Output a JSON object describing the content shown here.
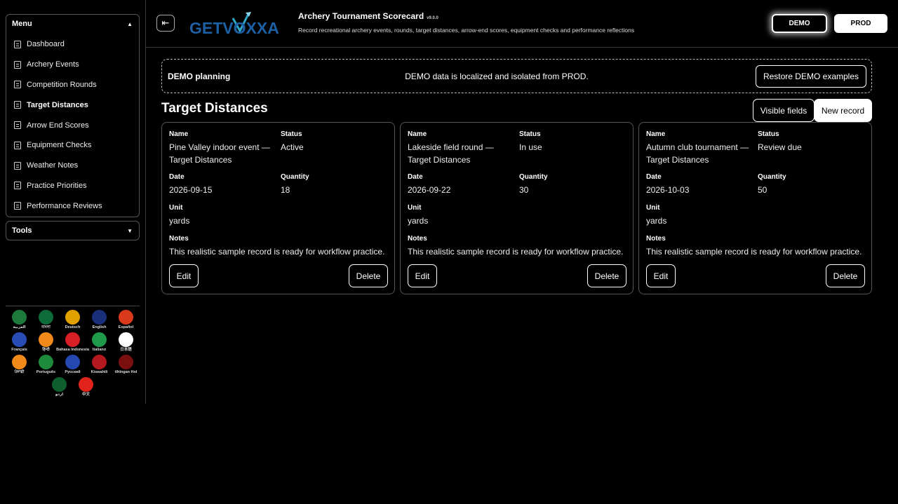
{
  "sidebar": {
    "menu_title": "Menu",
    "tools_title": "Tools",
    "items": [
      {
        "label": "Dashboard"
      },
      {
        "label": "Archery Events"
      },
      {
        "label": "Competition Rounds"
      },
      {
        "label": "Target Distances",
        "active": true
      },
      {
        "label": "Arrow End Scores"
      },
      {
        "label": "Equipment Checks"
      },
      {
        "label": "Weather Notes"
      },
      {
        "label": "Practice Priorities"
      },
      {
        "label": "Performance Reviews"
      }
    ],
    "languages": [
      {
        "label": "العربية",
        "color": "#1e7a3c"
      },
      {
        "label": "বাংলা",
        "color": "#0d6b3a"
      },
      {
        "label": "Deutsch",
        "color": "#e0a000"
      },
      {
        "label": "English",
        "color": "#1a2f7a"
      },
      {
        "label": "Español",
        "color": "#d93a1c"
      },
      {
        "label": "Français",
        "color": "#2a4db5"
      },
      {
        "label": "हिन्दी",
        "color": "#f28a1a"
      },
      {
        "label": "Bahasa Indonesia",
        "color": "#d91f26"
      },
      {
        "label": "Italiano",
        "color": "#1e9a4a"
      },
      {
        "label": "日本語",
        "color": "#ffffff"
      },
      {
        "label": "ਪੰਜਾਬੀ",
        "color": "#f28a1a"
      },
      {
        "label": "Português",
        "color": "#1e8a3c"
      },
      {
        "label": "Русский",
        "color": "#2448b0"
      },
      {
        "label": "Kiswahili",
        "color": "#b3191f"
      },
      {
        "label": "tlhIngan Hol",
        "color": "#7a0f0f"
      },
      {
        "label": "اردو",
        "color": "#0f5e2e"
      },
      {
        "label": "中文",
        "color": "#e0231b"
      }
    ]
  },
  "header": {
    "logo_text": "GETVOXXA",
    "title": "Archery Tournament Scorecard",
    "version": "v9.0.0",
    "subtitle": "Record recreational archery events, rounds, target distances, arrow-end scores, equipment checks and performance reflections",
    "demo_label": "DEMO",
    "prod_label": "PROD"
  },
  "banner": {
    "title": "DEMO planning",
    "message": "DEMO data is localized and isolated from PROD.",
    "restore_label": "Restore DEMO examples"
  },
  "main": {
    "title": "Target Distances",
    "visible_fields_label": "Visible fields",
    "new_record_label": "New record",
    "labels": {
      "name": "Name",
      "status": "Status",
      "date": "Date",
      "quantity": "Quantity",
      "unit": "Unit",
      "notes": "Notes"
    },
    "edit_label": "Edit",
    "delete_label": "Delete",
    "records": [
      {
        "name": "Pine Valley indoor event — Target Distances",
        "status": "Active",
        "date": "2026-09-15",
        "quantity": "18",
        "unit": "yards",
        "notes": "This realistic sample record is ready for workflow practice."
      },
      {
        "name": "Lakeside field round — Target Distances",
        "status": "In use",
        "date": "2026-09-22",
        "quantity": "30",
        "unit": "yards",
        "notes": "This realistic sample record is ready for workflow practice."
      },
      {
        "name": "Autumn club tournament — Target Distances",
        "status": "Review due",
        "date": "2026-10-03",
        "quantity": "50",
        "unit": "yards",
        "notes": "This realistic sample record is ready for workflow practice."
      }
    ]
  }
}
